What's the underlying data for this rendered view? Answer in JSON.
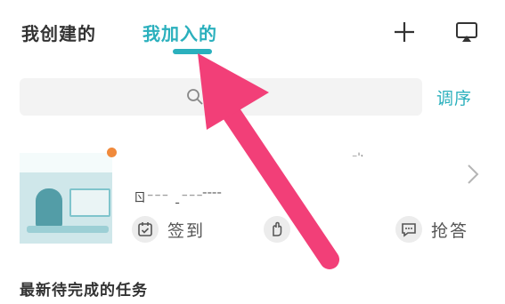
{
  "header": {
    "tabs": [
      {
        "label": "我创建的",
        "active": false
      },
      {
        "label": "我加入的",
        "active": true
      }
    ],
    "add_icon": "plus-icon",
    "screen_icon": "screen-cast-icon"
  },
  "search": {
    "placeholder": "",
    "value": "",
    "icon": "search-icon"
  },
  "sort_label": "调序",
  "class_card": {
    "title": "ㄖ⁻⁻⁻ ˍ⁻⁻⁻ ̄ ̄ ̄ ̄",
    "subtitle": "⁻ˈˑ",
    "has_unread": true,
    "actions": [
      {
        "label": "签到",
        "icon": "calendar-check-icon"
      },
      {
        "label": "手",
        "icon": "hand-raise-icon"
      },
      {
        "label": "抢答",
        "icon": "chat-bubble-icon"
      }
    ]
  },
  "section_title": "最新待完成的任务",
  "colors": {
    "accent": "#2bb0bd",
    "annotation_arrow": "#f23f78",
    "unread_dot": "#f08a3c"
  }
}
